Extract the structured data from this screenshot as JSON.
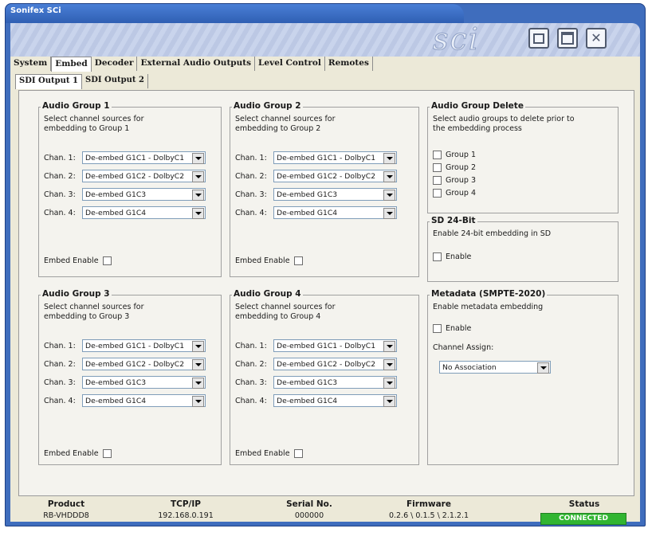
{
  "window": {
    "title": "Sonifex SCi",
    "logo": "sci"
  },
  "tabs": [
    "System",
    "Embed",
    "Decoder",
    "External Audio Outputs",
    "Level Control",
    "Remotes"
  ],
  "subtabs": [
    "SDI Output 1",
    "SDI Output 2"
  ],
  "groups": [
    {
      "title": "Audio Group 1",
      "desc1": "Select channel sources for",
      "desc2": "embedding to Group 1",
      "channels": [
        {
          "label": "Chan. 1:",
          "value": "De-embed G1C1 - DolbyC1"
        },
        {
          "label": "Chan. 2:",
          "value": "De-embed G1C2 - DolbyC2"
        },
        {
          "label": "Chan. 3:",
          "value": "De-embed G1C3"
        },
        {
          "label": "Chan. 4:",
          "value": "De-embed G1C4"
        }
      ],
      "enable_label": "Embed Enable"
    },
    {
      "title": "Audio Group 2",
      "desc1": "Select channel sources for",
      "desc2": "embedding to Group 2",
      "channels": [
        {
          "label": "Chan. 1:",
          "value": "De-embed G1C1 - DolbyC1"
        },
        {
          "label": "Chan. 2:",
          "value": "De-embed G1C2 - DolbyC2"
        },
        {
          "label": "Chan. 3:",
          "value": "De-embed G1C3"
        },
        {
          "label": "Chan. 4:",
          "value": "De-embed G1C4"
        }
      ],
      "enable_label": "Embed Enable"
    },
    {
      "title": "Audio Group 3",
      "desc1": "Select channel sources for",
      "desc2": "embedding to Group 3",
      "channels": [
        {
          "label": "Chan. 1:",
          "value": "De-embed G1C1 - DolbyC1"
        },
        {
          "label": "Chan. 2:",
          "value": "De-embed G1C2 - DolbyC2"
        },
        {
          "label": "Chan. 3:",
          "value": "De-embed G1C3"
        },
        {
          "label": "Chan. 4:",
          "value": "De-embed G1C4"
        }
      ],
      "enable_label": "Embed Enable"
    },
    {
      "title": "Audio Group 4",
      "desc1": "Select channel sources for",
      "desc2": "embedding to Group 4",
      "channels": [
        {
          "label": "Chan. 1:",
          "value": "De-embed G1C1 - DolbyC1"
        },
        {
          "label": "Chan. 2:",
          "value": "De-embed G1C2 - DolbyC2"
        },
        {
          "label": "Chan. 3:",
          "value": "De-embed G1C3"
        },
        {
          "label": "Chan. 4:",
          "value": "De-embed G1C4"
        }
      ],
      "enable_label": "Embed Enable"
    }
  ],
  "delete_group": {
    "title": "Audio Group Delete",
    "desc1": "Select audio groups to delete prior to",
    "desc2": "the embedding process",
    "items": [
      "Group 1",
      "Group 2",
      "Group 3",
      "Group 4"
    ]
  },
  "sd24": {
    "title": "SD 24-Bit",
    "desc": "Enable 24-bit embedding in SD",
    "enable_label": "Enable"
  },
  "metadata": {
    "title": "Metadata (SMPTE-2020)",
    "desc": "Enable metadata embedding",
    "enable_label": "Enable",
    "assign_label": "Channel Assign:",
    "assign_value": "No Association"
  },
  "status_bar": {
    "product": {
      "head": "Product",
      "value": "RB-VHDDD8"
    },
    "tcpip": {
      "head": "TCP/IP",
      "value": "192.168.0.191"
    },
    "serial": {
      "head": "Serial No.",
      "value": "000000"
    },
    "firmware": {
      "head": "Firmware",
      "value": "0.2.6 \\ 0.1.5 \\ 2.1.2.1"
    },
    "status": {
      "head": "Status",
      "value": "CONNECTED"
    }
  }
}
